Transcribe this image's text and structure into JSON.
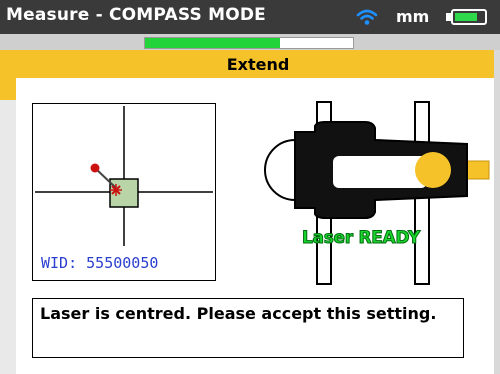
{
  "status_bar": {
    "title": "Measure - COMPASS MODE",
    "units": "mm",
    "wifi_icon": "wifi-icon",
    "battery_icon": "battery-icon",
    "battery_level": 0.8,
    "progress": 0.65,
    "progress_color": "#22d43a"
  },
  "dialog": {
    "title": "Extend",
    "header_color": "#f6c22a"
  },
  "target": {
    "wid_label": "WID: 55500050"
  },
  "sensor": {
    "status": "Laser READY",
    "status_color": "#19d62c",
    "lens_color": "#f6c22a"
  },
  "message": {
    "text": "Laser is centred. Please accept this setting."
  }
}
